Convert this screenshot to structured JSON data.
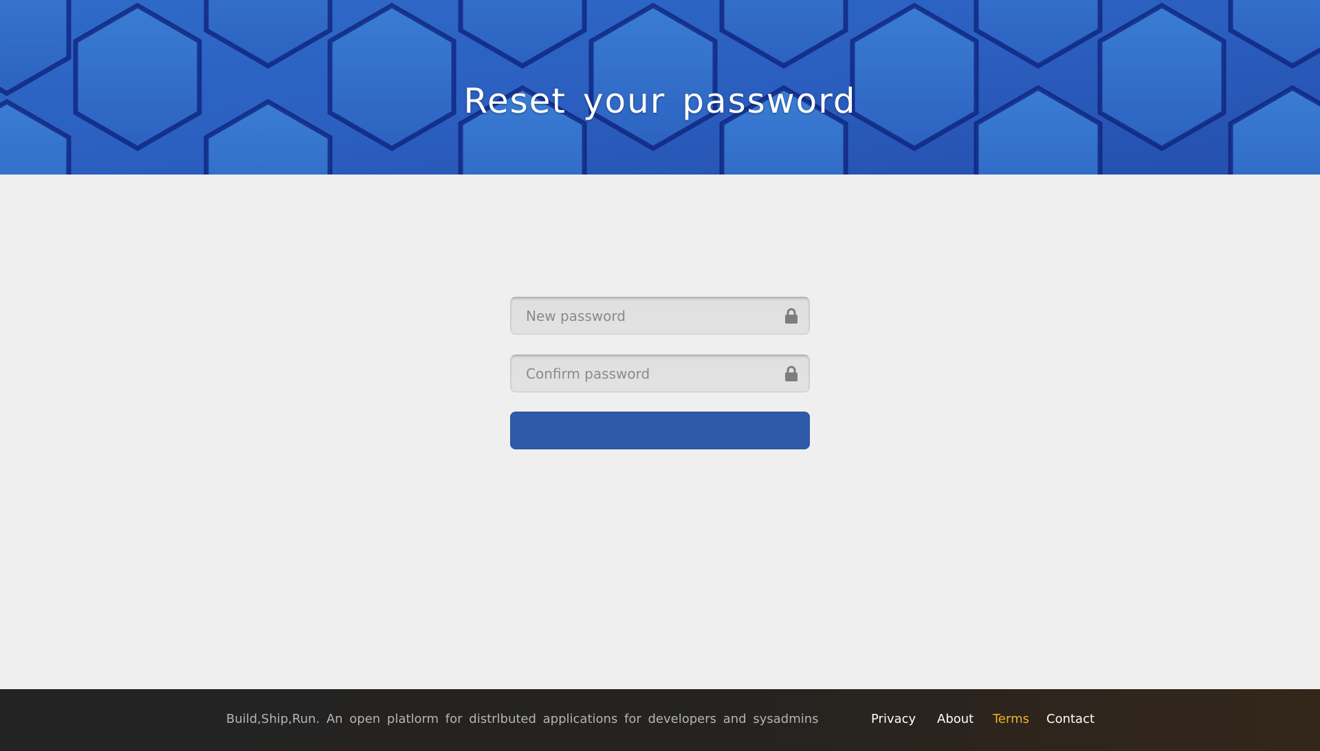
{
  "header": {
    "title": "Reset your password"
  },
  "form": {
    "new_password": {
      "placeholder": "New password",
      "value": "",
      "icon": "lock-icon"
    },
    "confirm_password": {
      "placeholder": "Confirm password",
      "value": "",
      "icon": "lock-icon"
    },
    "submit_label": ""
  },
  "footer": {
    "tagline": "Build,Ship,Run. An open platlorm for distrlbuted applications for developers and sysadmins",
    "links": [
      {
        "label": "Privacy",
        "active": false
      },
      {
        "label": "About",
        "active": false
      },
      {
        "label": "Terms",
        "active": true
      },
      {
        "label": "Contact",
        "active": false
      }
    ]
  },
  "colors": {
    "hero": "#2d5cb8",
    "button": "#2e5aa9",
    "page_background": "#efefef",
    "footer_background": "#232323",
    "active_link": "#f0b429"
  }
}
